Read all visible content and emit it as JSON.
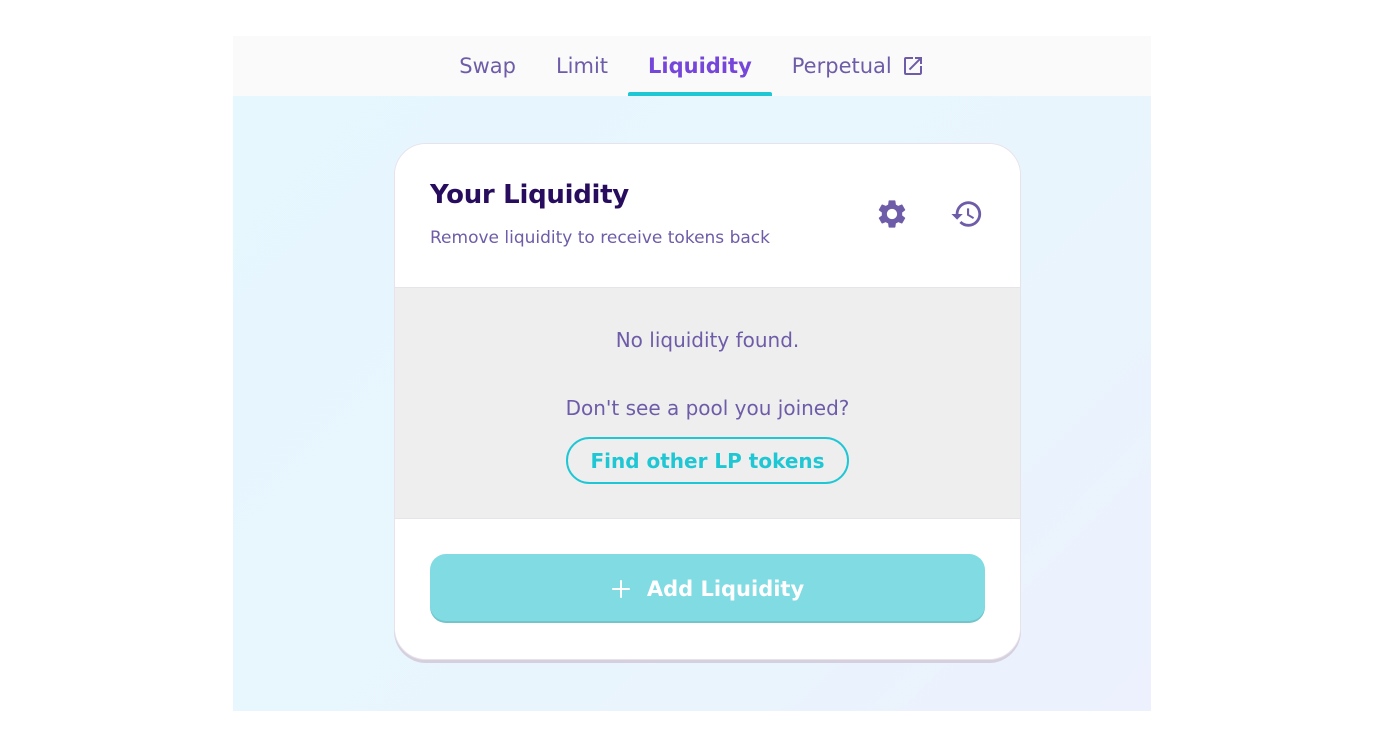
{
  "nav": {
    "tabs": [
      {
        "label": "Swap",
        "active": false
      },
      {
        "label": "Limit",
        "active": false
      },
      {
        "label": "Liquidity",
        "active": true
      },
      {
        "label": "Perpetual",
        "active": false,
        "icon": "external-link-icon"
      }
    ]
  },
  "card": {
    "title": "Your Liquidity",
    "subtitle": "Remove liquidity to receive tokens back",
    "icons": [
      "gear-icon",
      "history-icon"
    ],
    "empty_message": "No liquidity found.",
    "prompt": "Don't see a pool you joined?",
    "find_button": "Find other LP tokens",
    "add_button": "Add Liquidity"
  },
  "colors": {
    "primary_text": "#280d5f",
    "secondary_text": "#6e5ca8",
    "accent": "#1fc7d4",
    "active_tab": "#7645d9",
    "add_button_bg": "#80dbe2"
  }
}
